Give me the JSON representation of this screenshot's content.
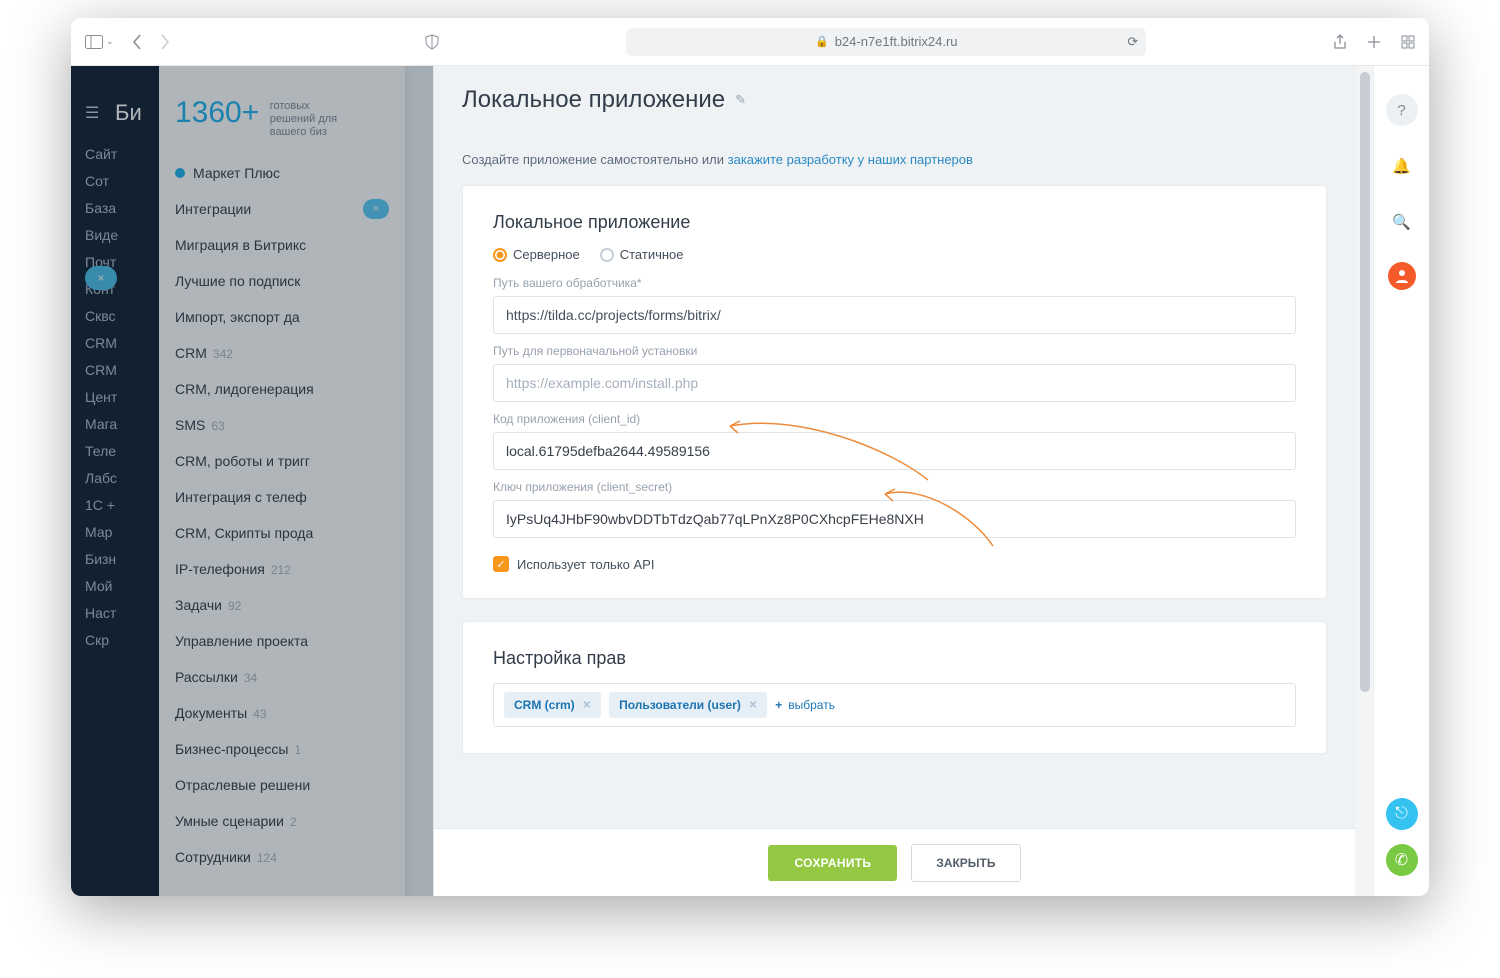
{
  "browser": {
    "url_host": "b24-n7e1ft.bitrix24.ru"
  },
  "left_rail": {
    "logo": "Би",
    "items": [
      "Сайт",
      "Сот",
      "База",
      "Виде",
      "Почт",
      "Конт",
      "Сквс",
      "CRM",
      "CRM",
      "Цент",
      "Мага",
      "Теле",
      "Лабс",
      "1С +",
      "Мар",
      "Бизн",
      "Мой",
      "Наст",
      "Скр"
    ]
  },
  "market": {
    "count": "1360+",
    "sub_line1": "готовых",
    "sub_line2": "решений для",
    "sub_line3": "вашего биз",
    "items": [
      {
        "label": "Маркет Плюс",
        "plus": true
      },
      {
        "label": "Интеграции",
        "integ": true
      },
      {
        "label": "Миграция в Битрикс"
      },
      {
        "label": "Лучшие по подписк"
      },
      {
        "label": "Импорт, экспорт да"
      },
      {
        "label": "CRM",
        "cnt": "342"
      },
      {
        "label": "CRM, лидогенерация"
      },
      {
        "label": "SMS",
        "cnt": "63"
      },
      {
        "label": "CRM, роботы и тригг"
      },
      {
        "label": "Интеграция с телеф"
      },
      {
        "label": "CRM, Скрипты прода"
      },
      {
        "label": "IP-телефония",
        "cnt": "212"
      },
      {
        "label": "Задачи",
        "cnt": "92"
      },
      {
        "label": "Управление проекта"
      },
      {
        "label": "Рассылки",
        "cnt": "34"
      },
      {
        "label": "Документы",
        "cnt": "43"
      },
      {
        "label": "Бизнес-процессы",
        "cnt": "1"
      },
      {
        "label": "Отраслевые решени"
      },
      {
        "label": "Умные сценарии",
        "cnt": "2"
      },
      {
        "label": "Сотрудники",
        "cnt": "124"
      }
    ]
  },
  "flyout": {
    "title": "Локальное приложение",
    "intro_text": "Создайте приложение самостоятельно или ",
    "intro_link": "закажите разработку у наших партнеров",
    "section_title": "Локальное приложение",
    "radio_server": "Серверное",
    "radio_static": "Статичное",
    "handler_label": "Путь вашего обработчика*",
    "handler_value": "https://tilda.cc/projects/forms/bitrix/",
    "install_label": "Путь для первоначальной установки",
    "install_placeholder": "https://example.com/install.php",
    "client_id_label": "Код приложения (client_id)",
    "client_id_value": "local.61795defba2644.49589156",
    "client_secret_label": "Ключ приложения (client_secret)",
    "client_secret_value": "IyPsUq4JHbF90wbvDDTbTdzQab77qLPnXz8P0CXhcpFEHe8NXH",
    "api_only_label": "Использует только API",
    "rights_title": "Настройка прав",
    "rights_tags": [
      "CRM (crm)",
      "Пользователи (user)"
    ],
    "add_select": "выбрать",
    "save": "СОХРАНИТЬ",
    "close": "ЗАКРЫТЬ"
  }
}
